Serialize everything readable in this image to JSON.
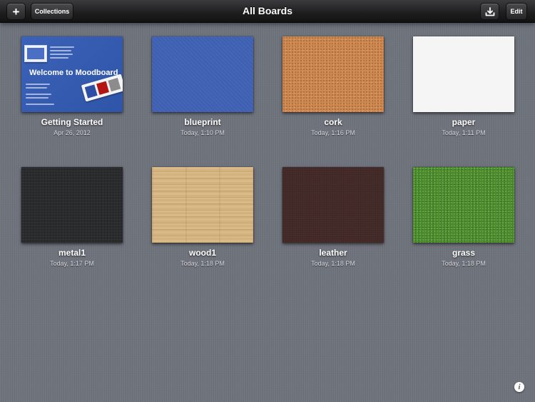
{
  "toolbar": {
    "title": "All Boards",
    "add_icon": "plus-icon",
    "add_label": "+",
    "collections_label": "Collections",
    "export_icon": "download-tray-icon",
    "edit_label": "Edit"
  },
  "getting_started_thumb": {
    "title": "Welcome to Moodboard"
  },
  "boards": [
    {
      "name": "Getting Started",
      "date": "Apr 26, 2012",
      "texture": "getting-started"
    },
    {
      "name": "blueprint",
      "date": "Today, 1:10 PM",
      "texture": "blueprint"
    },
    {
      "name": "cork",
      "date": "Today, 1:16 PM",
      "texture": "cork"
    },
    {
      "name": "paper",
      "date": "Today, 1:11 PM",
      "texture": "paper"
    },
    {
      "name": "metal1",
      "date": "Today, 1:17 PM",
      "texture": "metal"
    },
    {
      "name": "wood1",
      "date": "Today, 1:18 PM",
      "texture": "wood"
    },
    {
      "name": "leather",
      "date": "Today, 1:18 PM",
      "texture": "leather"
    },
    {
      "name": "grass",
      "date": "Today, 1:18 PM",
      "texture": "grass"
    }
  ],
  "info_button": {
    "icon": "info-icon",
    "label": "i"
  },
  "colors": {
    "background": "#6f737c",
    "toolbar": "#1d1d1e",
    "blueprint": "#3f60b4",
    "cork": "#cf8a52",
    "paper": "#f5f5f5",
    "metal": "#2a2b2d",
    "wood": "#d4b27f",
    "leather": "#4a2f2d",
    "grass": "#4b8a2f"
  }
}
